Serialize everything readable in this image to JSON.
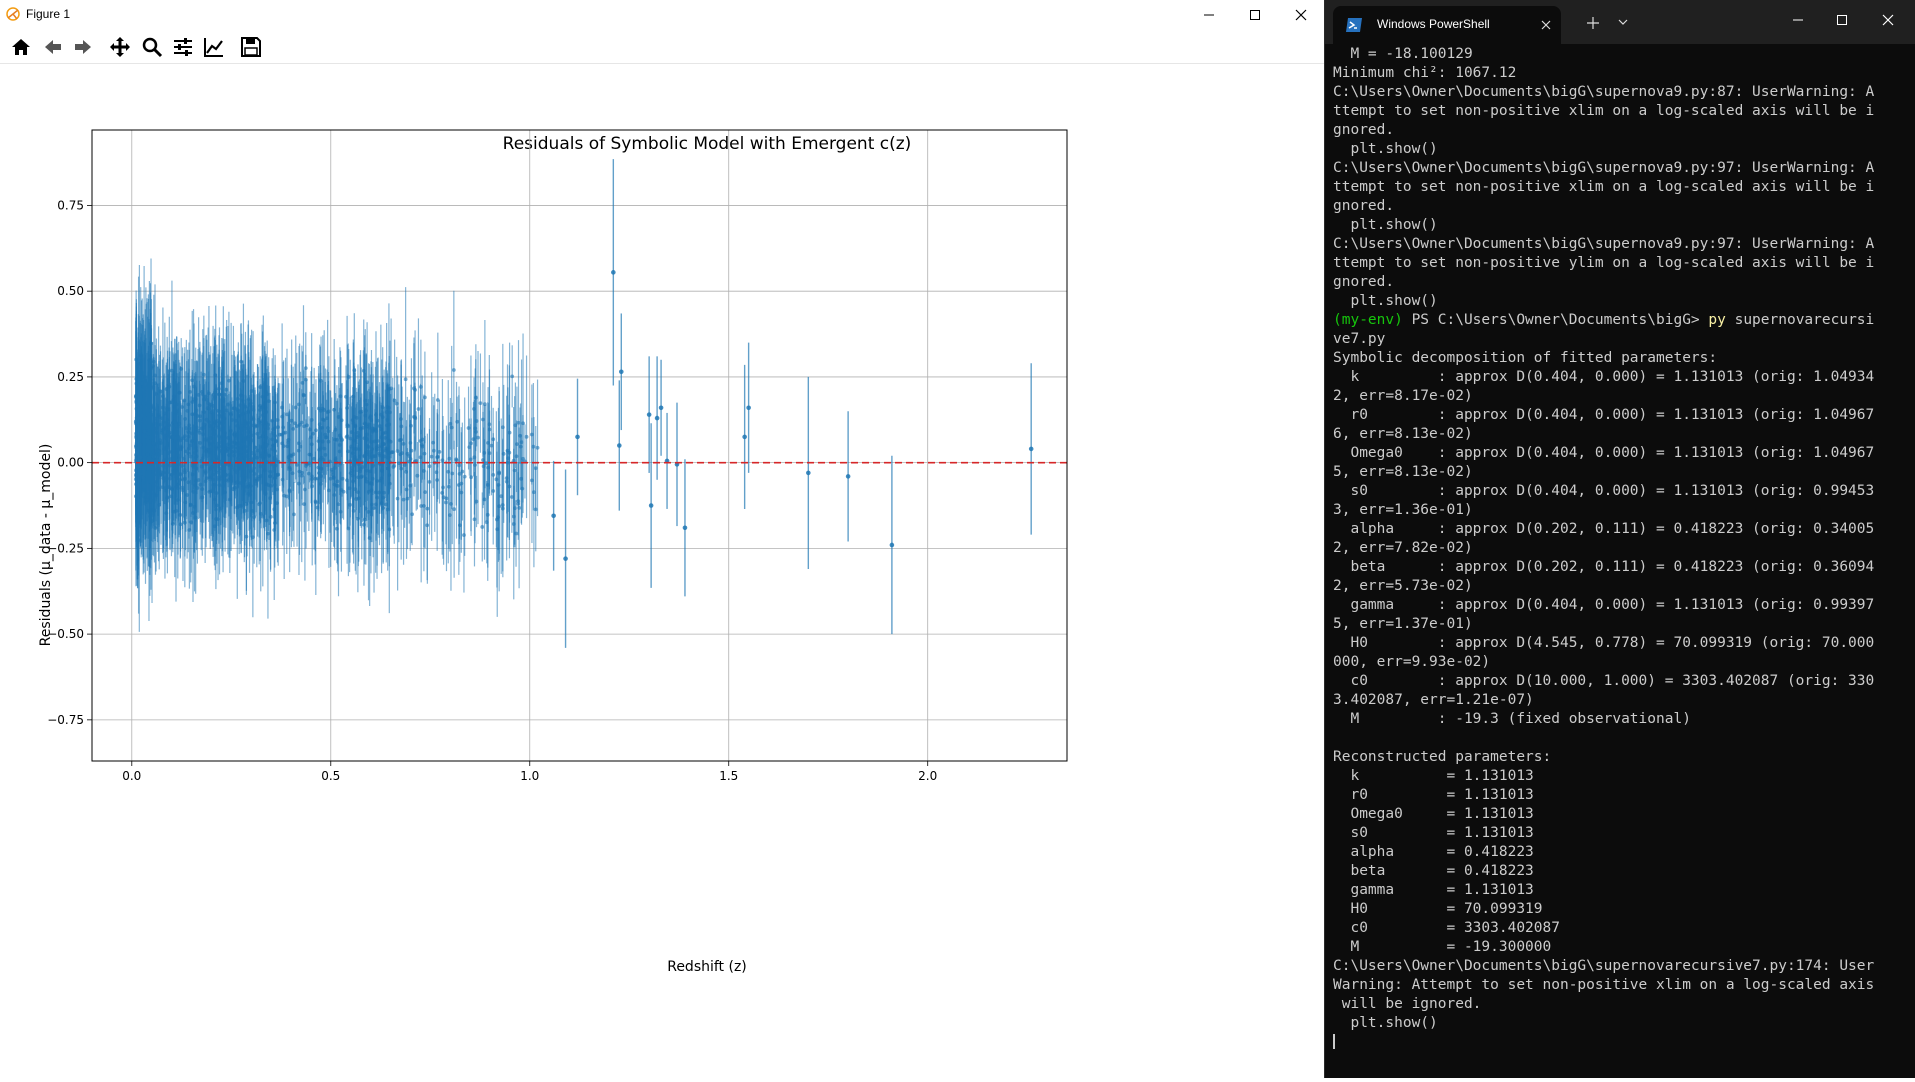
{
  "figure_window": {
    "title": "Figure 1",
    "toolbar": [
      {
        "icon": "home-icon"
      },
      {
        "icon": "back-arrow-icon"
      },
      {
        "icon": "forward-arrow-icon"
      },
      {
        "icon": "pan-move-icon"
      },
      {
        "icon": "zoom-magnifier-icon"
      },
      {
        "icon": "subplots-configure-icon"
      },
      {
        "icon": "edit-axis-icon"
      },
      {
        "icon": "save-icon"
      }
    ]
  },
  "chart_data": {
    "type": "scatter",
    "title": "Residuals of Symbolic Model with Emergent c(z)",
    "xlabel": "Redshift (z)",
    "ylabel": "Residuals (μ_data - μ_model)",
    "xlim": [
      -0.1,
      2.35
    ],
    "ylim": [
      -0.87,
      0.97
    ],
    "xticks": [
      0.0,
      0.5,
      1.0,
      1.5,
      2.0
    ],
    "xticklabels": [
      "0.0",
      "0.5",
      "1.0",
      "1.5",
      "2.0"
    ],
    "yticks": [
      -0.75,
      -0.5,
      -0.25,
      0.0,
      0.25,
      0.5,
      0.75
    ],
    "yticklabels": [
      "−0.75",
      "−0.50",
      "−0.25",
      "0.00",
      "0.25",
      "0.50",
      "0.75"
    ],
    "grid": true,
    "reference_line": {
      "y": 0.0,
      "color": "#d62728",
      "style": "dashed"
    },
    "series_color": "#1f77b4",
    "dense_region": {
      "x_range": [
        0.01,
        1.02
      ],
      "typical_y_range": [
        -0.45,
        0.6
      ],
      "note_count": "~1500 points"
    },
    "points": [
      {
        "x": 1.21,
        "y": 0.555,
        "err": 0.33
      },
      {
        "x": 1.23,
        "y": 0.265,
        "err": 0.17
      },
      {
        "x": 1.225,
        "y": 0.05,
        "err": 0.19
      },
      {
        "x": 1.12,
        "y": 0.075,
        "err": 0.17
      },
      {
        "x": 1.06,
        "y": -0.155,
        "err": 0.16
      },
      {
        "x": 1.09,
        "y": -0.28,
        "err": 0.26
      },
      {
        "x": 1.3,
        "y": 0.14,
        "err": 0.17
      },
      {
        "x": 1.305,
        "y": -0.125,
        "err": 0.24
      },
      {
        "x": 1.32,
        "y": 0.13,
        "err": 0.18
      },
      {
        "x": 1.33,
        "y": 0.16,
        "err": 0.14
      },
      {
        "x": 1.345,
        "y": 0.005,
        "err": 0.14
      },
      {
        "x": 1.37,
        "y": -0.005,
        "err": 0.18
      },
      {
        "x": 1.39,
        "y": -0.19,
        "err": 0.2
      },
      {
        "x": 1.54,
        "y": 0.075,
        "err": 0.21
      },
      {
        "x": 1.55,
        "y": 0.16,
        "err": 0.19
      },
      {
        "x": 1.7,
        "y": -0.03,
        "err": 0.28
      },
      {
        "x": 1.8,
        "y": -0.04,
        "err": 0.19
      },
      {
        "x": 1.91,
        "y": -0.24,
        "err": 0.26
      },
      {
        "x": 2.26,
        "y": 0.04,
        "err": 0.25
      }
    ]
  },
  "terminal": {
    "tab_title": "Windows PowerShell",
    "lines": [
      "  M = -18.100129",
      "Minimum chi²: 1067.12",
      "C:\\Users\\Owner\\Documents\\bigG\\supernova9.py:87: UserWarning: A",
      "ttempt to set non-positive xlim on a log-scaled axis will be i",
      "gnored.",
      "  plt.show()",
      "C:\\Users\\Owner\\Documents\\bigG\\supernova9.py:97: UserWarning: A",
      "ttempt to set non-positive xlim on a log-scaled axis will be i",
      "gnored.",
      "  plt.show()",
      "C:\\Users\\Owner\\Documents\\bigG\\supernova9.py:97: UserWarning: A",
      "ttempt to set non-positive ylim on a log-scaled axis will be i",
      "gnored.",
      "  plt.show()",
      "__PROMPT__",
      "ve7.py",
      "Symbolic decomposition of fitted parameters:",
      "  k         : approx D(0.404, 0.000) = 1.131013 (orig: 1.04934",
      "2, err=8.17e-02)",
      "  r0        : approx D(0.404, 0.000) = 1.131013 (orig: 1.04967",
      "6, err=8.13e-02)",
      "  Omega0    : approx D(0.404, 0.000) = 1.131013 (orig: 1.04967",
      "5, err=8.13e-02)",
      "  s0        : approx D(0.404, 0.000) = 1.131013 (orig: 0.99453",
      "3, err=1.36e-01)",
      "  alpha     : approx D(0.202, 0.111) = 0.418223 (orig: 0.34005",
      "2, err=7.82e-02)",
      "  beta      : approx D(0.202, 0.111) = 0.418223 (orig: 0.36094",
      "2, err=5.73e-02)",
      "  gamma     : approx D(0.404, 0.000) = 1.131013 (orig: 0.99397",
      "5, err=1.37e-01)",
      "  H0        : approx D(4.545, 0.778) = 70.099319 (orig: 70.000",
      "000, err=9.93e-02)",
      "  c0        : approx D(10.000, 1.000) = 3303.402087 (orig: 330",
      "3.402087, err=1.21e-07)",
      "  M         : -19.3 (fixed observational)",
      "",
      "Reconstructed parameters:",
      "  k          = 1.131013",
      "  r0         = 1.131013",
      "  Omega0     = 1.131013",
      "  s0         = 1.131013",
      "  alpha      = 0.418223",
      "  beta       = 0.418223",
      "  gamma      = 1.131013",
      "  H0         = 70.099319",
      "  c0         = 3303.402087",
      "  M          = -19.300000",
      "C:\\Users\\Owner\\Documents\\bigG\\supernovarecursive7.py:174: User",
      "Warning: Attempt to set non-positive xlim on a log-scaled axis",
      " will be ignored.",
      "  plt.show()"
    ],
    "prompt": {
      "env": "(my-env)",
      "path": " PS C:\\Users\\Owner\\Documents\\bigG> ",
      "cmd": "py",
      "args": " supernovarecursi"
    }
  }
}
